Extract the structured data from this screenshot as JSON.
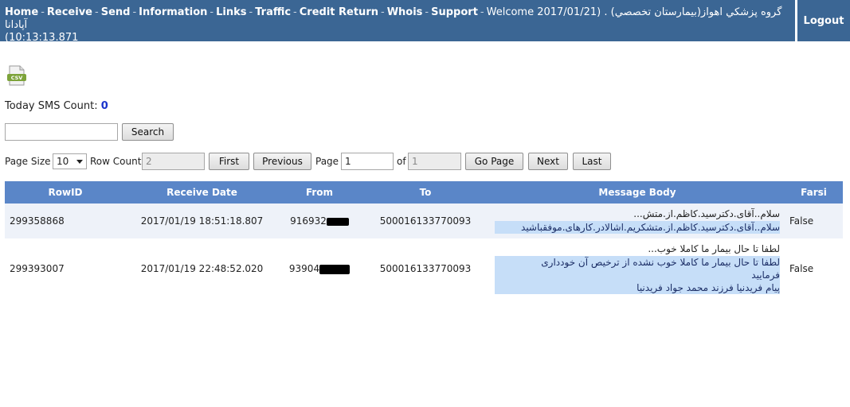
{
  "nav": {
    "links": [
      "Home",
      "Receive",
      "Send",
      "Information",
      "Links",
      "Traffic",
      "Credit Return",
      "Whois",
      "Support"
    ],
    "welcome": "Welcome 2017/01/21) . (گروه پزشكي اهواز(بيمارستان تخصصي آپادانا",
    "time": "(10:13:13.871",
    "logout": "Logout"
  },
  "icons": {
    "csv": "csv-file-icon"
  },
  "sms": {
    "label": "Today SMS Count:",
    "count": "0"
  },
  "search": {
    "value": "",
    "button": "Search"
  },
  "pager": {
    "page_size_label": "Page Size",
    "page_size": "10",
    "row_count_label": "Row Count",
    "row_count": "2",
    "first": "First",
    "previous": "Previous",
    "page_label": "Page",
    "page": "1",
    "of_label": "of",
    "total_pages": "1",
    "go_page": "Go Page",
    "next": "Next",
    "last": "Last"
  },
  "table": {
    "columns": [
      "RowID",
      "Receive Date",
      "From",
      "To",
      "Message Body",
      "Farsi"
    ],
    "rows": [
      {
        "row_id": "299358868",
        "receive_date": "2017/01/19 18:51:18.807",
        "from": "916932",
        "to": "500016133770093",
        "preview": "سلام..آقای.دکترسید.کاظم.از.متش...",
        "body": [
          "سلام..آقای.دکترسید.کاظم.از.متشکریم.اشالادر.کارهای.موفقباشید"
        ],
        "farsi": "False"
      },
      {
        "row_id": "299393007",
        "receive_date": "2017/01/19 22:48:52.020",
        "from": "93904",
        "to": "500016133770093",
        "preview": "لطفا تا حال بیمار ما کاملا خوب...",
        "body": [
          "لطفا تا حال بیمار ما کاملا خوب نشده از ترخیص آن خودداری",
          "فرمایید",
          "پیام فریدنیا فرزند محمد جواد فریدنیا"
        ],
        "farsi": "False"
      }
    ]
  },
  "colors": {
    "topbar": "#3b6694",
    "header": "#5a86c8",
    "highlight": "#c6def8",
    "count": "#1a33cc"
  }
}
